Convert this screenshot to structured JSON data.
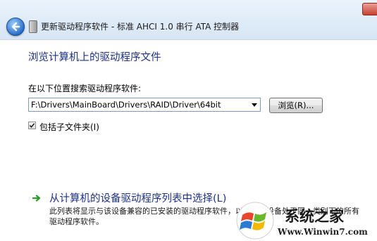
{
  "window": {
    "title": "更新驱动程序软件 - 标准 AHCI 1.0 串行 ATA 控制器"
  },
  "page": {
    "heading": "浏览计算机上的驱动程序文件"
  },
  "search": {
    "label": "在以下位置搜索驱动程序软件:",
    "path_value": "F:\\Drivers\\MainBoard\\Drivers\\RAID\\Driver\\64bit",
    "browse_label": "浏览(R)..."
  },
  "subfolders": {
    "label": "包括子文件夹(I)",
    "checked": true
  },
  "option": {
    "title": "从计算机的设备驱动程序列表中选择(L)",
    "description": "此列表将显示与该设备兼容的已安装的驱动程序软件，以及与该设备处于同一类别下的所有驱动程序软件。"
  },
  "watermark": {
    "brand": "系统之家",
    "url": "Www.Winwin7.com"
  },
  "icons": {
    "back": "back-arrow-icon",
    "device": "device-icon",
    "option": "green-arrow-icon",
    "close": "close-icon"
  },
  "colors": {
    "link_blue": "#1e3287",
    "option_arrow": "#2e9a2e"
  }
}
